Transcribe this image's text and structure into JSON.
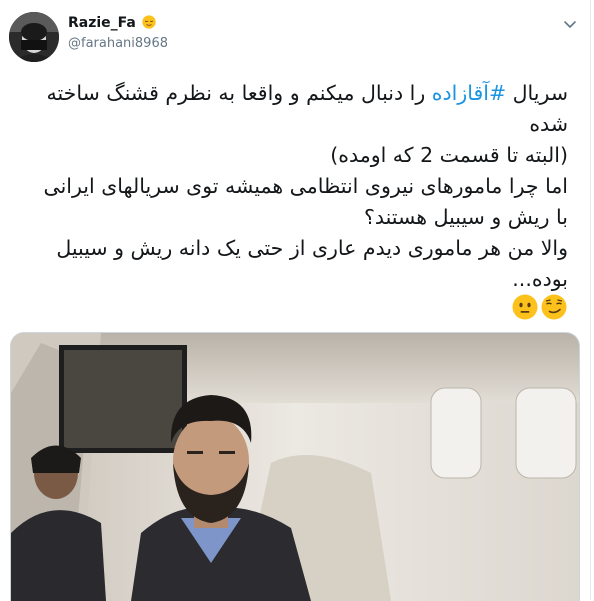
{
  "author": {
    "display_name": "Razie_Fa",
    "display_emoji": "relieved-face-emoji",
    "handle": "@farahani8968"
  },
  "tweet": {
    "lines": [
      {
        "before": "سریال ",
        "hashtag": "#آقازاده",
        "after": " را دنبال میکنم و واقعا به نظرم قشنگ ساخته"
      },
      {
        "text": "شده"
      },
      {
        "text": "(البته تا قسمت 2 که اومده)"
      },
      {
        "text": "اما چرا مامورهای نیروی انتظامی همیشه توی سریالهای ایرانی"
      },
      {
        "text": "با ریش و سیبیل هستند؟"
      },
      {
        "text": "والا من هر ماموری دیدم عاری از حتی یک دانه ریش و سیبیل"
      },
      {
        "text": "بوده..."
      }
    ],
    "trailing_emojis": [
      "smirking-face-emoji",
      "neutral-face-emoji"
    ]
  },
  "colors": {
    "hashtag": "#1b95e0",
    "name": "#14171a",
    "handle": "#657786",
    "border": "#ccd6dd"
  },
  "icons": {
    "menu": "chevron-down-icon"
  },
  "media": {
    "description_icon": "photo-man-in-airplane-seat"
  }
}
